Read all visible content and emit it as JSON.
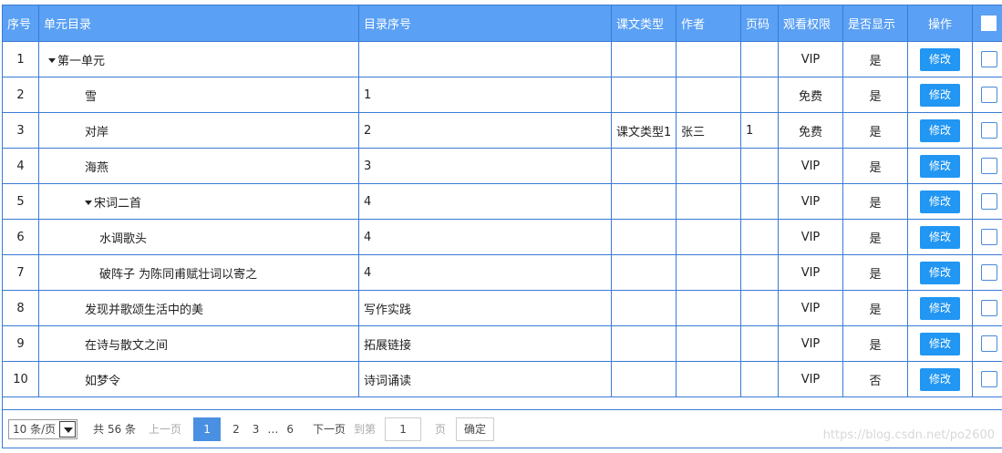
{
  "table": {
    "headers": {
      "seq": "序号",
      "unit": "单元目录",
      "dir_no": "目录序号",
      "type": "课文类型",
      "author": "作者",
      "page": "页码",
      "perm": "观看权限",
      "show": "是否显示",
      "op": "操作"
    },
    "edit_label": "修改",
    "rows": [
      {
        "seq": "1",
        "unit": "第一单元",
        "level": 1,
        "expander": true,
        "dir_no": "",
        "type": "",
        "author": "",
        "page": "",
        "perm": "VIP",
        "show": "是"
      },
      {
        "seq": "2",
        "unit": "雪",
        "level": 2,
        "expander": false,
        "dir_no": "1",
        "type": "",
        "author": "",
        "page": "",
        "perm": "免费",
        "show": "是"
      },
      {
        "seq": "3",
        "unit": "对岸",
        "level": 2,
        "expander": false,
        "dir_no": "2",
        "type": "课文类型1",
        "author": "张三",
        "page": "1",
        "perm": "免费",
        "show": "是"
      },
      {
        "seq": "4",
        "unit": "海燕",
        "level": 2,
        "expander": false,
        "dir_no": "3",
        "type": "",
        "author": "",
        "page": "",
        "perm": "VIP",
        "show": "是"
      },
      {
        "seq": "5",
        "unit": "宋词二首",
        "level": 2,
        "expander": true,
        "dir_no": "4",
        "type": "",
        "author": "",
        "page": "",
        "perm": "VIP",
        "show": "是"
      },
      {
        "seq": "6",
        "unit": "水调歌头",
        "level": 3,
        "expander": false,
        "dir_no": "4",
        "type": "",
        "author": "",
        "page": "",
        "perm": "VIP",
        "show": "是"
      },
      {
        "seq": "7",
        "unit": "破阵子 为陈同甫赋壮词以寄之",
        "level": 3,
        "expander": false,
        "dir_no": "4",
        "type": "",
        "author": "",
        "page": "",
        "perm": "VIP",
        "show": "是"
      },
      {
        "seq": "8",
        "unit": "发现并歌颂生活中的美",
        "level": 2,
        "expander": false,
        "dir_no": "写作实践",
        "type": "",
        "author": "",
        "page": "",
        "perm": "VIP",
        "show": "是"
      },
      {
        "seq": "9",
        "unit": "在诗与散文之间",
        "level": 2,
        "expander": false,
        "dir_no": "拓展链接",
        "type": "",
        "author": "",
        "page": "",
        "perm": "VIP",
        "show": "是"
      },
      {
        "seq": "10",
        "unit": "如梦令",
        "level": 2,
        "expander": false,
        "dir_no": "诗词诵读",
        "type": "",
        "author": "",
        "page": "",
        "perm": "VIP",
        "show": "否"
      }
    ]
  },
  "pager": {
    "page_size": "10 条/页",
    "total": "共 56 条",
    "prev": "上一页",
    "pages": [
      "1",
      "2",
      "3"
    ],
    "current": "1",
    "ellipsis": "…",
    "last": "6",
    "next": "下一页",
    "goto_label": "到第",
    "goto_value": "1",
    "page_unit": "页",
    "confirm": "确定"
  },
  "watermark": "https://blog.csdn.net/po2600",
  "colors": {
    "header_bg": "#5aa0f4",
    "border": "#3a7bd5",
    "button": "#2196f3",
    "current_page": "#4a90e2"
  }
}
